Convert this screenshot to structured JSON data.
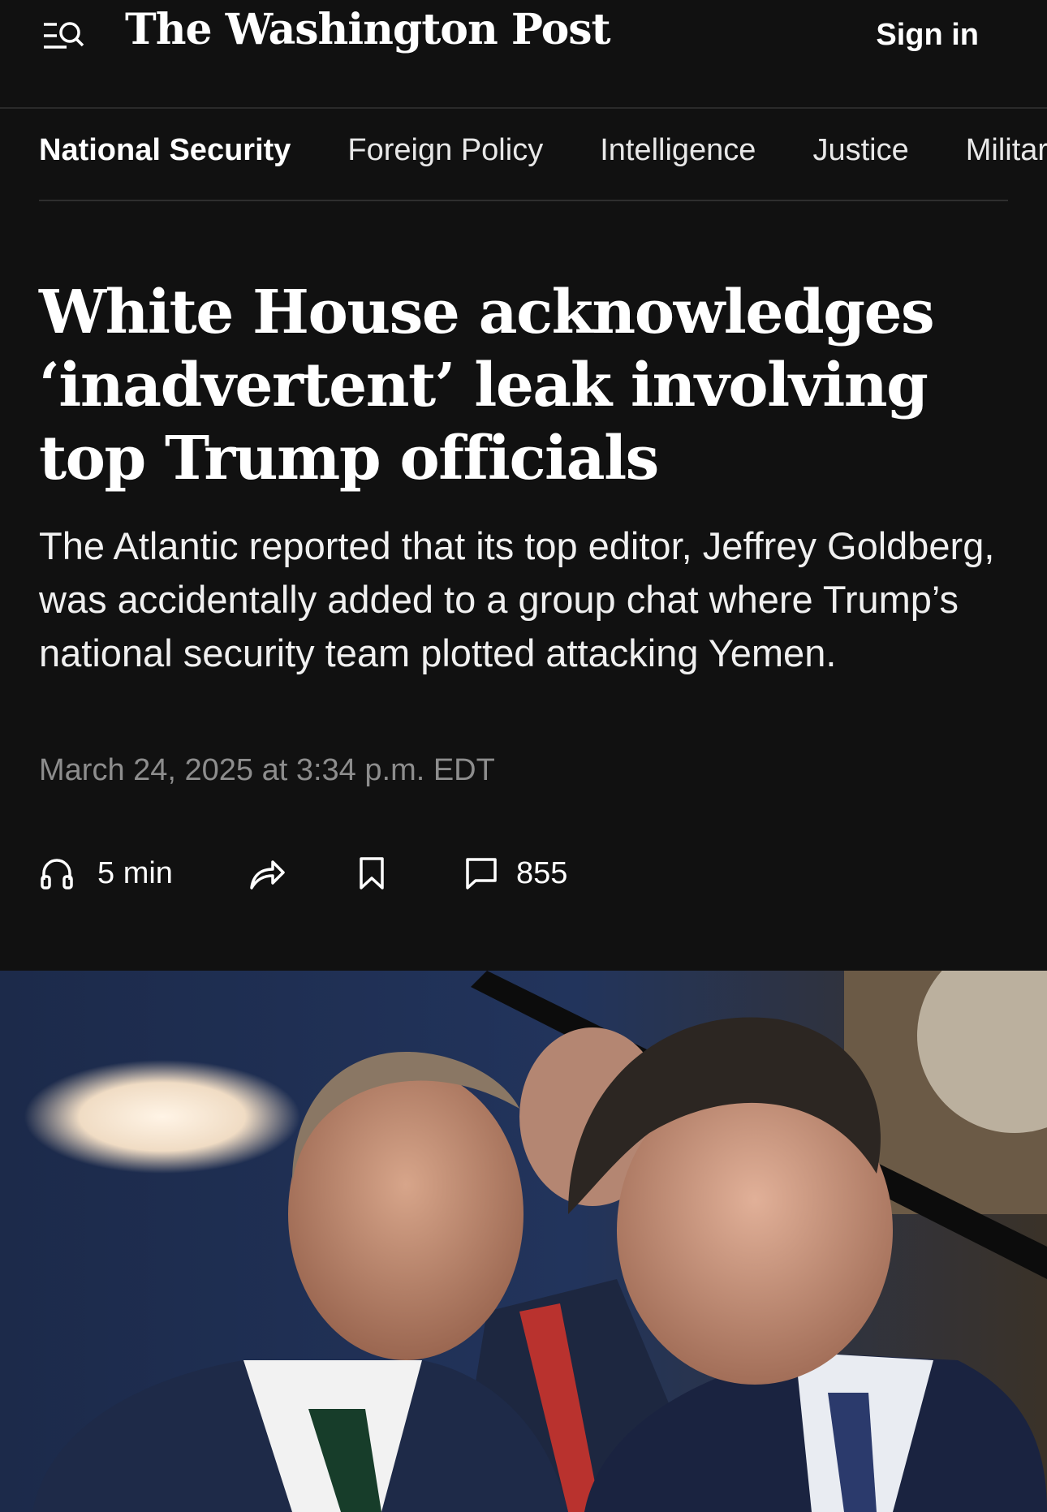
{
  "header": {
    "logo": "The Washington Post",
    "sign_in": "Sign in",
    "menu_icon": "menu-search-icon"
  },
  "subnav": {
    "items": [
      {
        "label": "National Security",
        "active": true
      },
      {
        "label": "Foreign Policy"
      },
      {
        "label": "Intelligence"
      },
      {
        "label": "Justice"
      },
      {
        "label": "Military"
      }
    ]
  },
  "article": {
    "headline": "White House acknowledges ‘inadvertent’ leak involving top Trump officials",
    "dek": "The Atlantic reported that its top editor, Jeffrey Goldberg, was accidentally added to a group chat where Trump’s national security team plotted attacking Yemen.",
    "timestamp": "March 24, 2025 at 3:34 p.m. EDT"
  },
  "actions": {
    "listen_label": "5 min",
    "comments_count": "855",
    "icons": [
      "headphones-icon",
      "share-icon",
      "bookmark-icon",
      "comment-icon"
    ]
  },
  "colors": {
    "background": "#111111",
    "text": "#ffffff",
    "muted": "#8d8d8d",
    "divider": "#2e2e2e"
  }
}
